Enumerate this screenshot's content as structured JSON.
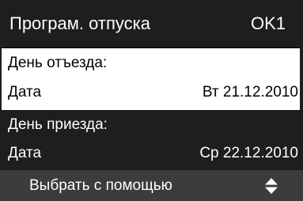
{
  "header": {
    "title": "Програм. отпуска",
    "code": "OK1"
  },
  "departure": {
    "heading": "День отъезда:",
    "date_label": "Дата",
    "date_value": "Вт 21.12.2010"
  },
  "arrival": {
    "heading": "День приезда:",
    "date_label": "Дата",
    "date_value": "Ср 22.12.2010"
  },
  "footer": {
    "hint": "Выбрать с помощью",
    "icon": "up-down-arrows-icon"
  },
  "colors": {
    "screen_background": "#1e1e1e",
    "selection_background": "#ffffff",
    "footer_background": "#3c3c3c",
    "text_light": "#ffffff",
    "text_dark": "#000000"
  }
}
